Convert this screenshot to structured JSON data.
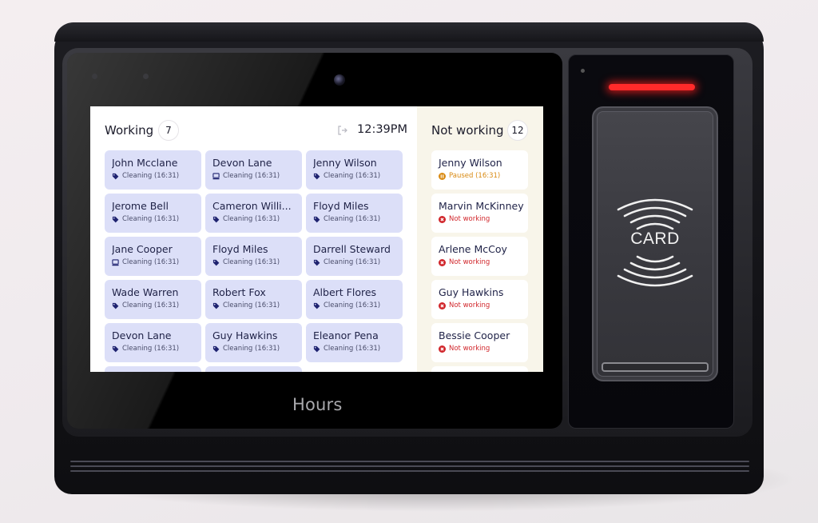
{
  "device": {
    "brand_label": "Hours",
    "card_reader_label": "CARD"
  },
  "screen": {
    "working": {
      "title": "Working",
      "count": "7",
      "clock": "12:39PM",
      "clock_icon": "logout-icon",
      "employees": [
        {
          "name": "John Mcclane",
          "status": "Cleaning (16:31)",
          "icon": "tag-icon"
        },
        {
          "name": "Devon Lane",
          "status": "Cleaning (16:31)",
          "icon": "computer-icon"
        },
        {
          "name": "Jenny Wilson",
          "status": "Cleaning (16:31)",
          "icon": "tag-icon"
        },
        {
          "name": "Jerome Bell",
          "status": "Cleaning (16:31)",
          "icon": "tag-icon"
        },
        {
          "name": "Cameron Willi...",
          "status": "Cleaning (16:31)",
          "icon": "tag-icon"
        },
        {
          "name": "Floyd Miles",
          "status": "Cleaning (16:31)",
          "icon": "tag-icon"
        },
        {
          "name": "Jane Cooper",
          "status": "Cleaning (16:31)",
          "icon": "computer-icon"
        },
        {
          "name": "Floyd Miles",
          "status": "Cleaning (16:31)",
          "icon": "tag-icon"
        },
        {
          "name": "Darrell Steward",
          "status": "Cleaning (16:31)",
          "icon": "tag-icon"
        },
        {
          "name": "Wade Warren",
          "status": "Cleaning (16:31)",
          "icon": "tag-icon"
        },
        {
          "name": "Robert Fox",
          "status": "Cleaning (16:31)",
          "icon": "tag-icon"
        },
        {
          "name": "Albert Flores",
          "status": "Cleaning (16:31)",
          "icon": "tag-icon"
        },
        {
          "name": "Devon Lane",
          "status": "Cleaning (16:31)",
          "icon": "tag-icon"
        },
        {
          "name": "Guy Hawkins",
          "status": "Cleaning (16:31)",
          "icon": "tag-icon"
        },
        {
          "name": "Eleanor Pena",
          "status": "Cleaning (16:31)",
          "icon": "tag-icon"
        },
        {
          "name": "",
          "status": "",
          "icon": ""
        },
        {
          "name": "",
          "status": "",
          "icon": ""
        }
      ]
    },
    "not_working": {
      "title": "Not working",
      "count": "12",
      "employees": [
        {
          "name": "Jenny Wilson",
          "status": "Paused (16:31)",
          "icon": "pause-icon",
          "color": "#d98a12"
        },
        {
          "name": "Marvin McKinney",
          "status": "Not working",
          "icon": "x-circle-icon",
          "color": "#d1262b"
        },
        {
          "name": "Arlene McCoy",
          "status": "Not working",
          "icon": "x-circle-icon",
          "color": "#d1262b"
        },
        {
          "name": "Guy Hawkins",
          "status": "Not working",
          "icon": "x-circle-icon",
          "color": "#d1262b"
        },
        {
          "name": "Bessie Cooper",
          "status": "Not working",
          "icon": "x-circle-icon",
          "color": "#d1262b"
        },
        {
          "name": "",
          "status": "",
          "icon": "",
          "color": ""
        }
      ]
    }
  },
  "colors": {
    "working_card_bg": "#dcdff8",
    "not_working_bg": "#f8f5ea",
    "text_dark": "#1f2247",
    "paused": "#d98a12",
    "not_working": "#d1262b",
    "led": "#ff2a2a"
  }
}
